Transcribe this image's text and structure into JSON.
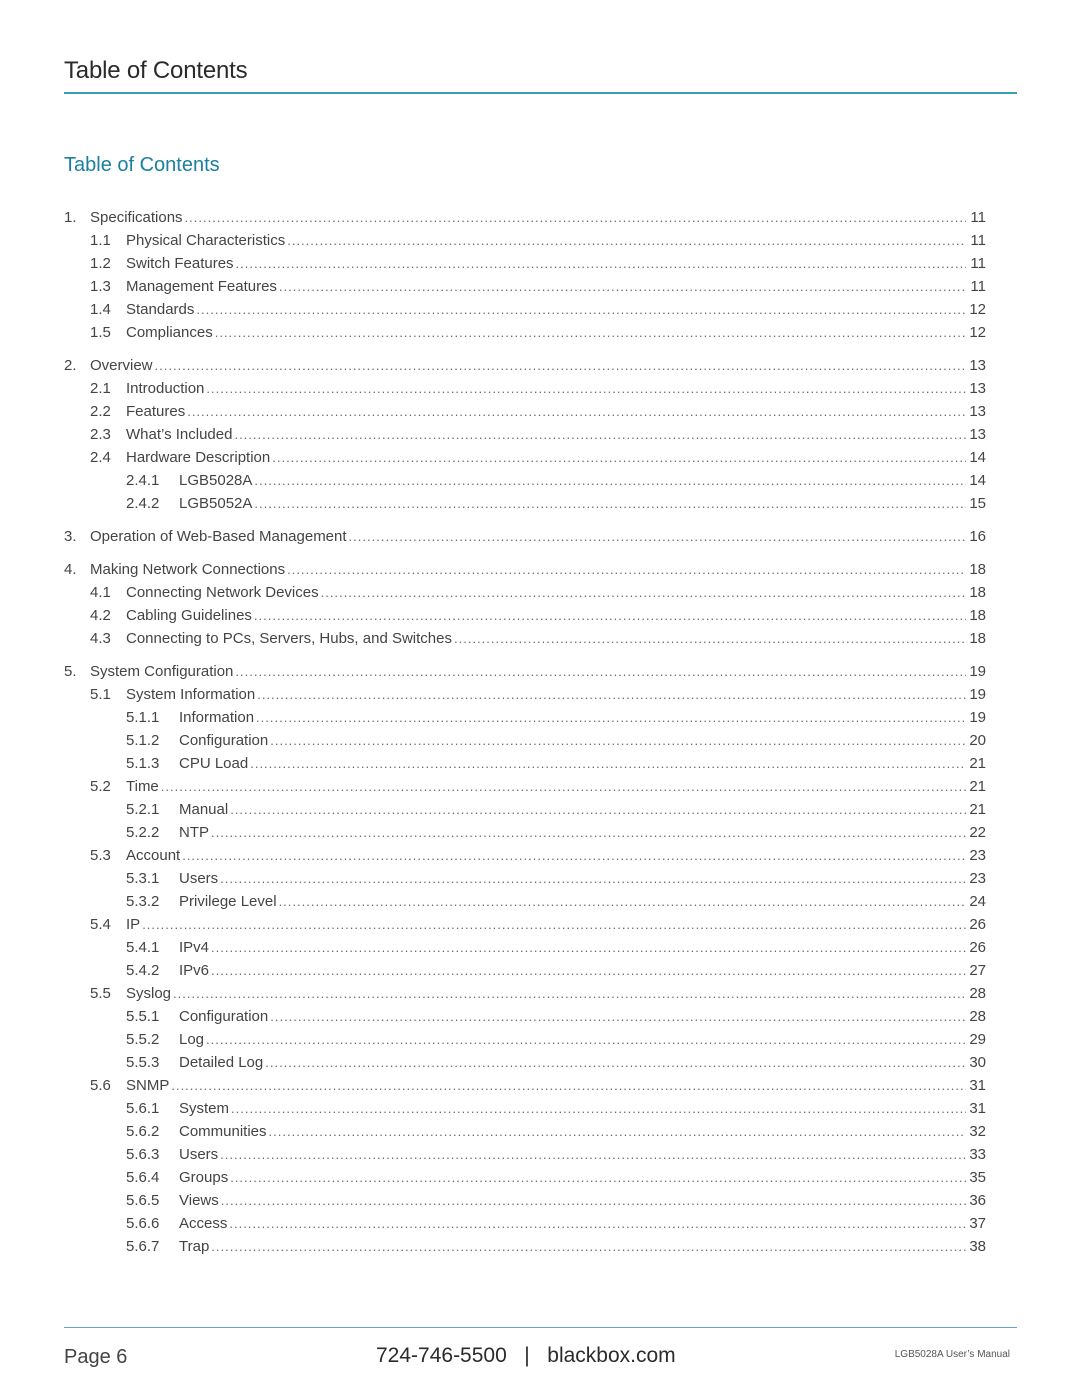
{
  "header": {
    "title": "Table of Contents"
  },
  "toc_heading": "Table of Contents",
  "colors": {
    "accent_rule": "#3a9fb3",
    "heading": "#1c7fa0",
    "footer_rule": "#6a9fd4"
  },
  "toc": [
    {
      "level": 1,
      "num": "1.",
      "title": "Specifications",
      "page": "11"
    },
    {
      "level": 2,
      "num": "1.1",
      "title": "Physical Characteristics",
      "page": "11"
    },
    {
      "level": 2,
      "num": "1.2",
      "title": "Switch Features",
      "page": "11"
    },
    {
      "level": 2,
      "num": "1.3",
      "title": "Management Features",
      "page": "11"
    },
    {
      "level": 2,
      "num": "1.4",
      "title": "Standards",
      "page": "12"
    },
    {
      "level": 2,
      "num": "1.5",
      "title": "Compliances",
      "page": "12"
    },
    {
      "level": 1,
      "num": "2.",
      "title": "Overview",
      "page": "13",
      "gap": true
    },
    {
      "level": 2,
      "num": "2.1",
      "title": "Introduction",
      "page": "13"
    },
    {
      "level": 2,
      "num": "2.2",
      "title": "Features",
      "page": "13"
    },
    {
      "level": 2,
      "num": "2.3",
      "title": "What’s Included",
      "page": "13"
    },
    {
      "level": 2,
      "num": "2.4",
      "title": "Hardware Description",
      "page": "14"
    },
    {
      "level": 3,
      "num": "2.4.1",
      "title": "LGB5028A",
      "page": "14"
    },
    {
      "level": 3,
      "num": "2.4.2",
      "title": "LGB5052A",
      "page": "15"
    },
    {
      "level": 1,
      "num": "3.",
      "title": "Operation of Web-Based Management",
      "page": "16",
      "gap": true
    },
    {
      "level": 1,
      "num": "4.",
      "title": "Making Network Connections",
      "page": "18",
      "gap": true
    },
    {
      "level": 2,
      "num": "4.1",
      "title": "Connecting Network Devices",
      "page": "18"
    },
    {
      "level": 2,
      "num": "4.2",
      "title": "Cabling Guidelines",
      "page": "18"
    },
    {
      "level": 2,
      "num": "4.3",
      "title": "Connecting to PCs, Servers, Hubs, and Switches",
      "page": "18"
    },
    {
      "level": 1,
      "num": "5.",
      "title": "System Configuration",
      "page": "19",
      "gap": true
    },
    {
      "level": 2,
      "num": "5.1",
      "title": "System Information",
      "page": "19"
    },
    {
      "level": 3,
      "num": "5.1.1",
      "title": "Information",
      "page": "19"
    },
    {
      "level": 3,
      "num": "5.1.2",
      "title": "Configuration",
      "page": "20"
    },
    {
      "level": 3,
      "num": "5.1.3",
      "title": "CPU Load",
      "page": "21"
    },
    {
      "level": 2,
      "num": "5.2",
      "title": "Time",
      "page": "21"
    },
    {
      "level": 3,
      "num": "5.2.1",
      "title": "Manual",
      "page": "21"
    },
    {
      "level": 3,
      "num": "5.2.2",
      "title": "NTP",
      "page": "22"
    },
    {
      "level": 2,
      "num": "5.3",
      "title": "Account",
      "page": "23"
    },
    {
      "level": 3,
      "num": "5.3.1",
      "title": "Users",
      "page": "23"
    },
    {
      "level": 3,
      "num": "5.3.2",
      "title": "Privilege Level",
      "page": "24"
    },
    {
      "level": 2,
      "num": "5.4",
      "title": "IP",
      "page": "26"
    },
    {
      "level": 3,
      "num": "5.4.1",
      "title": "IPv4",
      "page": "26"
    },
    {
      "level": 3,
      "num": "5.4.2",
      "title": "IPv6",
      "page": "27"
    },
    {
      "level": 2,
      "num": "5.5",
      "title": "Syslog",
      "page": "28"
    },
    {
      "level": 3,
      "num": "5.5.1",
      "title": "Configuration",
      "page": "28"
    },
    {
      "level": 3,
      "num": "5.5.2",
      "title": "Log",
      "page": "29"
    },
    {
      "level": 3,
      "num": "5.5.3",
      "title": "Detailed Log",
      "page": "30"
    },
    {
      "level": 2,
      "num": "5.6",
      "title": "SNMP",
      "page": "31"
    },
    {
      "level": 3,
      "num": "5.6.1",
      "title": "System",
      "page": "31"
    },
    {
      "level": 3,
      "num": "5.6.2",
      "title": "Communities",
      "page": "32"
    },
    {
      "level": 3,
      "num": "5.6.3",
      "title": "Users",
      "page": "33"
    },
    {
      "level": 3,
      "num": "5.6.4",
      "title": "Groups",
      "page": "35"
    },
    {
      "level": 3,
      "num": "5.6.5",
      "title": "Views",
      "page": "36"
    },
    {
      "level": 3,
      "num": "5.6.6",
      "title": "Access",
      "page": "37"
    },
    {
      "level": 3,
      "num": "5.6.7",
      "title": "Trap",
      "page": "38"
    }
  ],
  "footer": {
    "page_label": "Page 6",
    "phone": "724-746-5500",
    "separator": "|",
    "website": "blackbox.com",
    "manual": "LGB5028A User’s Manual"
  }
}
